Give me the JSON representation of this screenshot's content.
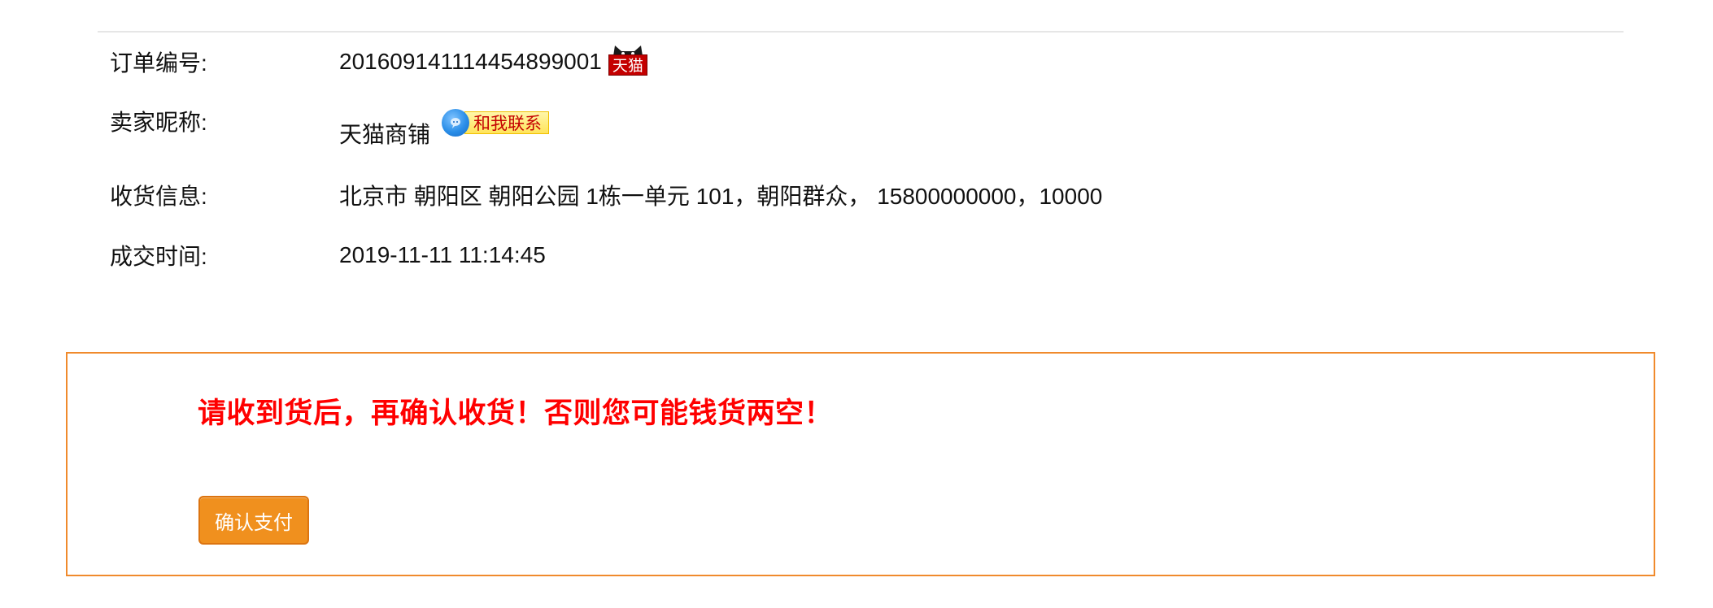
{
  "order_info": {
    "order_number_label": "订单编号:",
    "order_number_value": "20160914111445489​9001",
    "tmall_badge_text": "天猫",
    "seller_label": "卖家昵称:",
    "seller_value": "天猫商铺",
    "contact_button_text": "和我联系",
    "address_label": "收货信息:",
    "address_value": "北京市 朝阳区 朝阳公园 1栋一单元 101，朝阳群众， 15800000000，10000",
    "deal_time_label": "成交时间:",
    "deal_time_value": "2019-11-11 11:14:45"
  },
  "notice": {
    "warning_text": "请收到货后，再确认收货！否则您可能钱货两空！",
    "confirm_button_label": "确认支付"
  },
  "colors": {
    "warning_red": "#ff0000",
    "panel_border_orange": "#f08a2c",
    "button_orange": "#f0901e",
    "tmall_red": "#c40000",
    "divider_gray": "#e6e6e6"
  },
  "icons": {
    "tmall": "tmall-cat-icon",
    "wangwang": "wangwang-chat-icon"
  }
}
